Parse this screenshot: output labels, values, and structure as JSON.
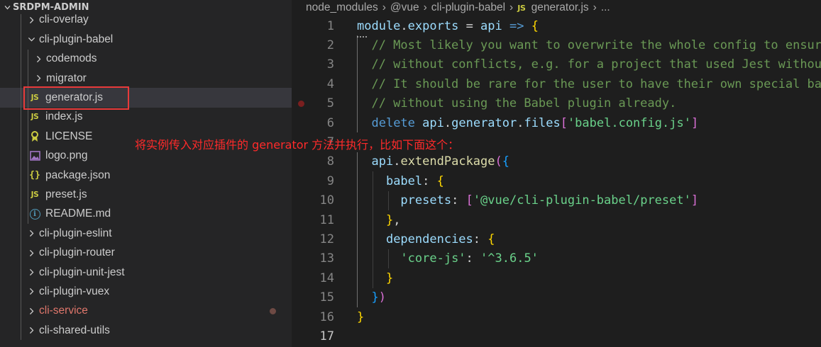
{
  "explorer": {
    "root_label": "SRDPM-ADMIN",
    "items": [
      {
        "label": "cli-overlay",
        "type": "folder",
        "expanded": false,
        "depth": 1
      },
      {
        "label": "cli-plugin-babel",
        "type": "folder",
        "expanded": true,
        "depth": 1
      },
      {
        "label": "codemods",
        "type": "folder",
        "expanded": false,
        "depth": 2
      },
      {
        "label": "migrator",
        "type": "folder",
        "expanded": false,
        "depth": 2
      },
      {
        "label": "generator.js",
        "type": "js",
        "depth": 2,
        "selected": true
      },
      {
        "label": "index.js",
        "type": "js",
        "depth": 2
      },
      {
        "label": "LICENSE",
        "type": "license",
        "depth": 2
      },
      {
        "label": "logo.png",
        "type": "image",
        "depth": 2
      },
      {
        "label": "package.json",
        "type": "json",
        "depth": 2
      },
      {
        "label": "preset.js",
        "type": "js",
        "depth": 2
      },
      {
        "label": "README.md",
        "type": "info",
        "depth": 2
      },
      {
        "label": "cli-plugin-eslint",
        "type": "folder",
        "expanded": false,
        "depth": 1
      },
      {
        "label": "cli-plugin-router",
        "type": "folder",
        "expanded": false,
        "depth": 1
      },
      {
        "label": "cli-plugin-unit-jest",
        "type": "folder",
        "expanded": false,
        "depth": 1
      },
      {
        "label": "cli-plugin-vuex",
        "type": "folder",
        "expanded": false,
        "depth": 1
      },
      {
        "label": "cli-service",
        "type": "folder",
        "expanded": false,
        "depth": 1,
        "modified": true
      },
      {
        "label": "cli-shared-utils",
        "type": "folder",
        "expanded": false,
        "depth": 1
      }
    ]
  },
  "breadcrumb": {
    "segments": [
      "node_modules",
      "@vue",
      "cli-plugin-babel"
    ],
    "file_badge": "JS",
    "file": "generator.js",
    "trailing": "..."
  },
  "icons": {
    "js": "JS",
    "json": "{}",
    "info": "i"
  },
  "editor": {
    "line_numbers": [
      "1",
      "2",
      "3",
      "4",
      "5",
      "6",
      "7",
      "8",
      "9",
      "10",
      "11",
      "12",
      "13",
      "14",
      "15",
      "16",
      "17"
    ],
    "active_line": "17",
    "lines": [
      [
        {
          "t": "module",
          "c": "c-var"
        },
        {
          "t": ".",
          "c": "c-op"
        },
        {
          "t": "exports",
          "c": "c-var"
        },
        {
          "t": " = ",
          "c": "c-op"
        },
        {
          "t": "api",
          "c": "c-var"
        },
        {
          "t": " ",
          "c": "c-op"
        },
        {
          "t": "=>",
          "c": "c-kw"
        },
        {
          "t": " ",
          "c": "c-op"
        },
        {
          "t": "{",
          "c": "c-b1"
        }
      ],
      [
        {
          "t": "  // Most likely you want to overwrite the whole config to ensure it's working",
          "c": "c-comment"
        }
      ],
      [
        {
          "t": "  // without conflicts, e.g. for a project that used Jest without Babel.",
          "c": "c-comment"
        }
      ],
      [
        {
          "t": "  // It should be rare for the user to have their own special babel config",
          "c": "c-comment"
        }
      ],
      [
        {
          "t": "  // without using the Babel plugin already.",
          "c": "c-comment"
        }
      ],
      [
        {
          "t": "  ",
          "c": "c-op"
        },
        {
          "t": "delete",
          "c": "c-kw"
        },
        {
          "t": " ",
          "c": "c-op"
        },
        {
          "t": "api",
          "c": "c-var"
        },
        {
          "t": ".",
          "c": "c-op"
        },
        {
          "t": "generator",
          "c": "c-var"
        },
        {
          "t": ".",
          "c": "c-op"
        },
        {
          "t": "files",
          "c": "c-var"
        },
        {
          "t": "[",
          "c": "c-b2"
        },
        {
          "t": "'babel.config.js'",
          "c": "c-str-green"
        },
        {
          "t": "]",
          "c": "c-b2"
        }
      ],
      [],
      [
        {
          "t": "  ",
          "c": "c-op"
        },
        {
          "t": "api",
          "c": "c-var"
        },
        {
          "t": ".",
          "c": "c-op"
        },
        {
          "t": "extendPackage",
          "c": "c-fn"
        },
        {
          "t": "(",
          "c": "c-b2"
        },
        {
          "t": "{",
          "c": "c-b3"
        }
      ],
      [
        {
          "t": "    ",
          "c": "c-op"
        },
        {
          "t": "babel",
          "c": "c-prop"
        },
        {
          "t": ": ",
          "c": "c-op"
        },
        {
          "t": "{",
          "c": "c-b1"
        }
      ],
      [
        {
          "t": "      ",
          "c": "c-op"
        },
        {
          "t": "presets",
          "c": "c-prop"
        },
        {
          "t": ": ",
          "c": "c-op"
        },
        {
          "t": "[",
          "c": "c-b2"
        },
        {
          "t": "'@vue/cli-plugin-babel/preset'",
          "c": "c-str-green"
        },
        {
          "t": "]",
          "c": "c-b2"
        }
      ],
      [
        {
          "t": "    ",
          "c": "c-op"
        },
        {
          "t": "}",
          "c": "c-b1"
        },
        {
          "t": ",",
          "c": "c-op"
        }
      ],
      [
        {
          "t": "    ",
          "c": "c-op"
        },
        {
          "t": "dependencies",
          "c": "c-prop"
        },
        {
          "t": ": ",
          "c": "c-op"
        },
        {
          "t": "{",
          "c": "c-b1"
        }
      ],
      [
        {
          "t": "      ",
          "c": "c-op"
        },
        {
          "t": "'core-js'",
          "c": "c-str-green"
        },
        {
          "t": ": ",
          "c": "c-op"
        },
        {
          "t": "'^3.6.5'",
          "c": "c-str-green"
        }
      ],
      [
        {
          "t": "    ",
          "c": "c-op"
        },
        {
          "t": "}",
          "c": "c-b1"
        }
      ],
      [
        {
          "t": "  ",
          "c": "c-op"
        },
        {
          "t": "}",
          "c": "c-b3"
        },
        {
          "t": ")",
          "c": "c-b2"
        }
      ],
      [
        {
          "t": "}",
          "c": "c-b1"
        }
      ],
      []
    ]
  },
  "annotation": "将实例传入对应插件的 generator 方法并执行，比如下面这个："
}
